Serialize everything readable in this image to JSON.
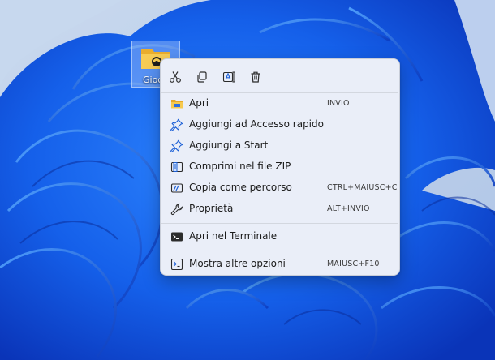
{
  "desktop": {
    "icon": {
      "label": "Gioc",
      "icon": "folder-icon",
      "color": "#f4c64e"
    }
  },
  "context_menu": {
    "toolbar": [
      {
        "name": "cut",
        "icon": "scissors-icon"
      },
      {
        "name": "copy",
        "icon": "copy-icon"
      },
      {
        "name": "rename",
        "icon": "rename-icon"
      },
      {
        "name": "delete",
        "icon": "trash-icon"
      }
    ],
    "items": [
      {
        "label": "Apri",
        "shortcut": "INVIO",
        "icon": "folder-icon"
      },
      {
        "label": "Aggiungi ad Accesso rapido",
        "shortcut": "",
        "icon": "pin-icon"
      },
      {
        "label": "Aggiungi a Start",
        "shortcut": "",
        "icon": "pin-icon"
      },
      {
        "label": "Comprimi nel file ZIP",
        "shortcut": "",
        "icon": "zip-icon"
      },
      {
        "label": "Copia come percorso",
        "shortcut": "CTRL+MAIUSC+C",
        "icon": "path-icon"
      },
      {
        "label": "Proprietà",
        "shortcut": "ALT+INVIO",
        "icon": "wrench-icon"
      },
      {
        "label": "Apri nel Terminale",
        "shortcut": "",
        "icon": "terminal-icon"
      },
      {
        "label": "Mostra altre opzioni",
        "shortcut": "MAIUSC+F10",
        "icon": "more-options-icon"
      }
    ]
  },
  "colors": {
    "accent": "#0a5fd4",
    "wallpaper_light": "#c4d6ef",
    "wallpaper_deep": "#0b3fc8"
  }
}
